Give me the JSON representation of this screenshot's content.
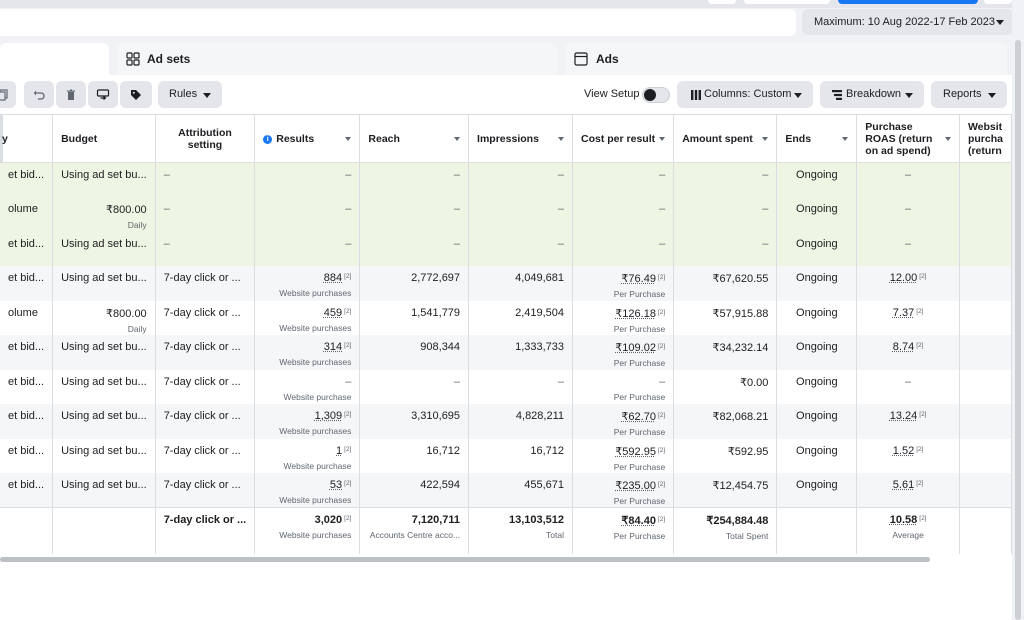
{
  "header": {
    "date_range": "Maximum: 10 Aug 2022-17 Feb 2023"
  },
  "tabs": {
    "adsets": "Ad sets",
    "ads": "Ads"
  },
  "toolbar": {
    "rules": "Rules",
    "view_setup": "View Setup",
    "columns": "Columns: Custom",
    "breakdown": "Breakdown",
    "reports": "Reports"
  },
  "columns": {
    "strategy": "y",
    "budget": "Budget",
    "attribution": "Attribution setting",
    "results": "Results",
    "reach": "Reach",
    "impressions": "Impressions",
    "cost_per_result": "Cost per result",
    "amount_spent": "Amount spent",
    "ends": "Ends",
    "purchase_roas": "Purchase ROAS (return on ad spend)",
    "website_purchase": "Websit purcha (return"
  },
  "rows": [
    {
      "style": "green",
      "strategy": "et bid...",
      "budget": "Using ad set bu...",
      "budget_sub": "",
      "attribution": "–",
      "results": "–",
      "results_sub": "",
      "reach": "–",
      "impressions": "–",
      "cpr": "–",
      "cpr_sub": "",
      "spent": "–",
      "ends": "Ongoing",
      "roas": "–"
    },
    {
      "style": "green",
      "strategy": "olume",
      "budget": "₹800.00",
      "budget_sub": "Daily",
      "attribution": "–",
      "results": "–",
      "results_sub": "",
      "reach": "–",
      "impressions": "–",
      "cpr": "–",
      "cpr_sub": "",
      "spent": "–",
      "ends": "Ongoing",
      "roas": "–"
    },
    {
      "style": "green",
      "strategy": "et bid...",
      "budget": "Using ad set bu...",
      "budget_sub": "",
      "attribution": "–",
      "results": "–",
      "results_sub": "",
      "reach": "–",
      "impressions": "–",
      "cpr": "–",
      "cpr_sub": "",
      "spent": "–",
      "ends": "Ongoing",
      "roas": "–"
    },
    {
      "style": "grey",
      "strategy": "et bid...",
      "budget": "Using ad set bu...",
      "budget_sub": "",
      "attribution": "7-day click or ...",
      "results": "884",
      "results_sub": "Website purchases",
      "reach": "2,772,697",
      "impressions": "4,049,681",
      "cpr": "₹76.49",
      "cpr_sub": "Per Purchase",
      "spent": "₹67,620.55",
      "ends": "Ongoing",
      "roas": "12.00"
    },
    {
      "style": "white",
      "strategy": "olume",
      "budget": "₹800.00",
      "budget_sub": "Daily",
      "attribution": "7-day click or ...",
      "results": "459",
      "results_sub": "Website purchases",
      "reach": "1,541,779",
      "impressions": "2,419,504",
      "cpr": "₹126.18",
      "cpr_sub": "Per Purchase",
      "spent": "₹57,915.88",
      "ends": "Ongoing",
      "roas": "7.37"
    },
    {
      "style": "grey",
      "strategy": "et bid...",
      "budget": "Using ad set bu...",
      "budget_sub": "",
      "attribution": "7-day click or ...",
      "results": "314",
      "results_sub": "Website purchases",
      "reach": "908,344",
      "impressions": "1,333,733",
      "cpr": "₹109.02",
      "cpr_sub": "Per Purchase",
      "spent": "₹34,232.14",
      "ends": "Ongoing",
      "roas": "8.74"
    },
    {
      "style": "white",
      "strategy": "et bid...",
      "budget": "Using ad set bu...",
      "budget_sub": "",
      "attribution": "7-day click or ...",
      "results": "–",
      "results_sub": "Website purchase",
      "reach": "–",
      "impressions": "–",
      "cpr": "–",
      "cpr_sub": "Per Purchase",
      "spent": "₹0.00",
      "ends": "Ongoing",
      "roas": "–"
    },
    {
      "style": "grey",
      "strategy": "et bid...",
      "budget": "Using ad set bu...",
      "budget_sub": "",
      "attribution": "7-day click or ...",
      "results": "1,309",
      "results_sub": "Website purchases",
      "reach": "3,310,695",
      "impressions": "4,828,211",
      "cpr": "₹62.70",
      "cpr_sub": "Per Purchase",
      "spent": "₹82,068.21",
      "ends": "Ongoing",
      "roas": "13.24"
    },
    {
      "style": "white",
      "strategy": "et bid...",
      "budget": "Using ad set bu...",
      "budget_sub": "",
      "attribution": "7-day click or ...",
      "results": "1",
      "results_sub": "Website purchase",
      "reach": "16,712",
      "impressions": "16,712",
      "cpr": "₹592.95",
      "cpr_sub": "Per Purchase",
      "spent": "₹592.95",
      "ends": "Ongoing",
      "roas": "1.52"
    },
    {
      "style": "grey",
      "strategy": "et bid...",
      "budget": "Using ad set bu...",
      "budget_sub": "",
      "attribution": "7-day click or ...",
      "results": "53",
      "results_sub": "Website purchases",
      "reach": "422,594",
      "impressions": "455,671",
      "cpr": "₹235.00",
      "cpr_sub": "Per Purchase",
      "spent": "₹12,454.75",
      "ends": "Ongoing",
      "roas": "5.61"
    }
  ],
  "footnote": "[2]",
  "totals": {
    "attribution": "7-day click or ...",
    "results": "3,020",
    "results_sub": "Website purchases",
    "reach": "7,120,711",
    "reach_sub": "Accounts Centre acco...",
    "impressions": "13,103,512",
    "impressions_sub": "Total",
    "cpr": "₹84.40",
    "cpr_sub": "Per Purchase",
    "spent": "₹254,884.48",
    "spent_sub": "Total Spent",
    "roas": "10.58",
    "roas_sub": "Average"
  },
  "colors": {
    "accent": "#1877f2",
    "row_green": "#eef6e3",
    "row_grey": "#f5f6f7"
  }
}
